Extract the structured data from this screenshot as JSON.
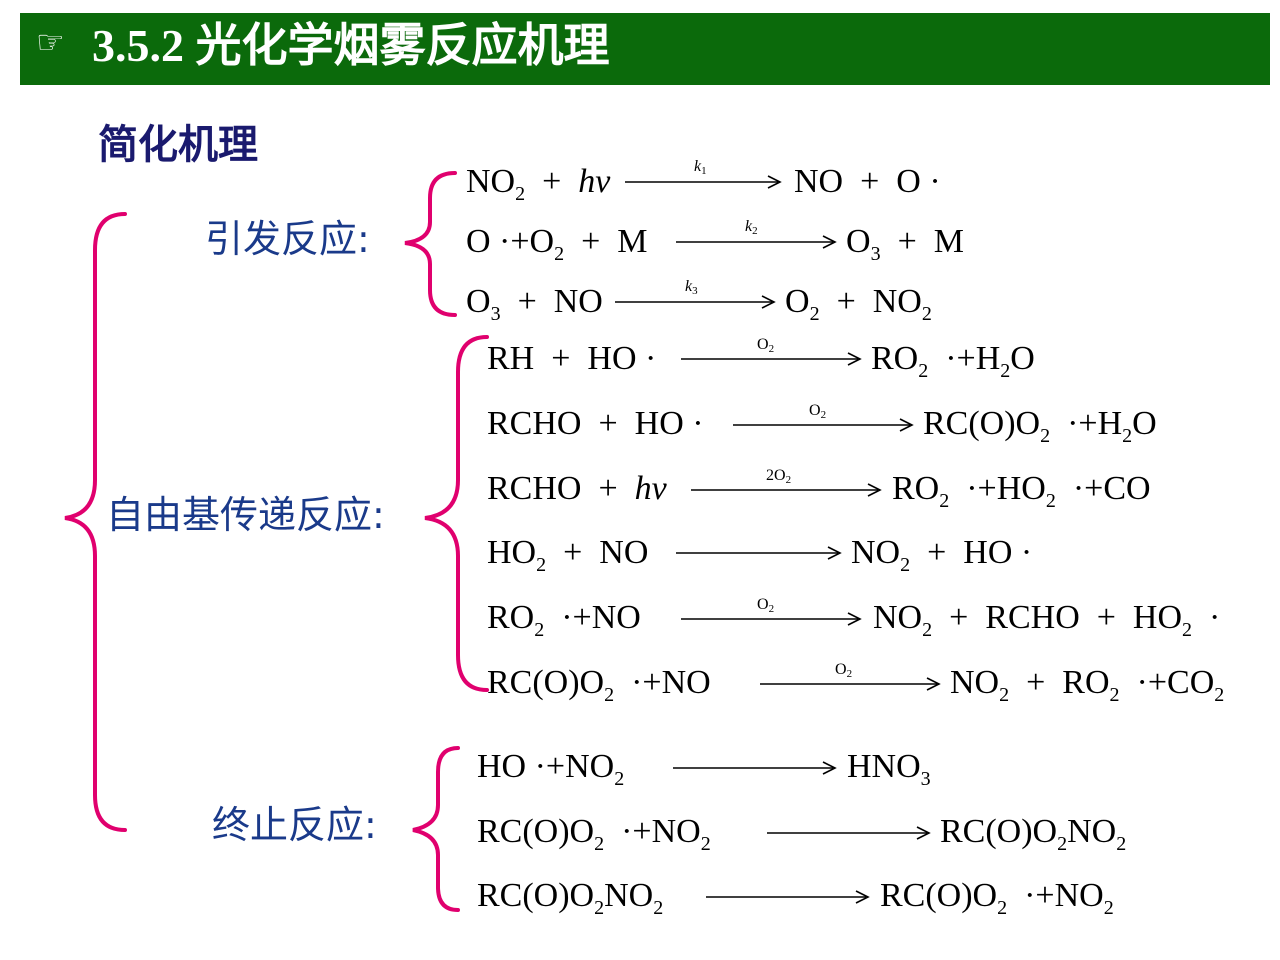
{
  "header": {
    "icon": "hand-pointing-right-icon",
    "title": "3.5.2 光化学烟雾反应机理"
  },
  "subtitle": "简化机理",
  "sections": {
    "initiation": "引发反应:",
    "propagation": "自由基传递反应:",
    "termination": "终止反应:"
  },
  "colors": {
    "title_bar": "#0b6a0b",
    "brace": "#e0006e",
    "label": "#1a3a8a"
  }
}
